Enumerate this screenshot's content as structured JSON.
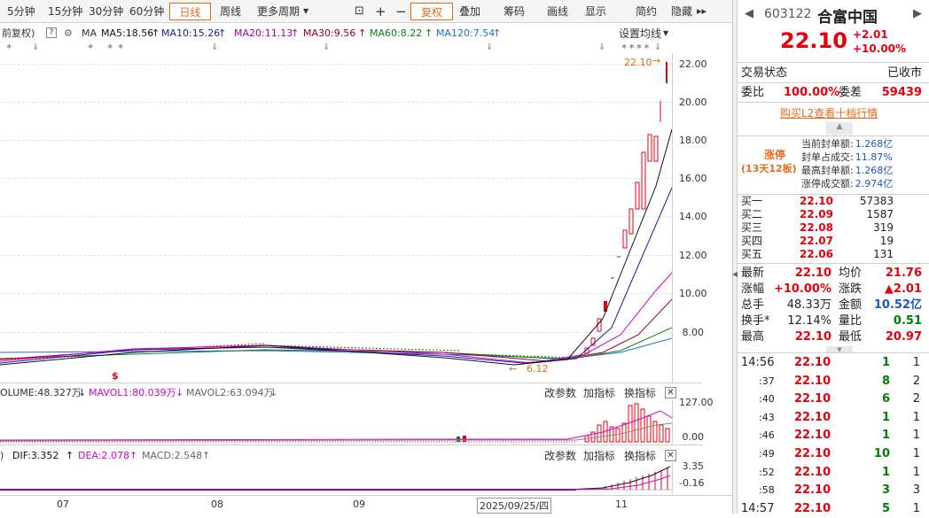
{
  "toolbar": {
    "periods": [
      "5分钟",
      "15分钟",
      "30分钟",
      "60分钟",
      "日线",
      "周线",
      "更多周期"
    ],
    "selected_period": "日线",
    "tools": [
      "复权",
      "叠加",
      "筹码",
      "画线",
      "显示",
      "简约",
      "隐藏"
    ],
    "nav_arrows": "▸▸"
  },
  "indicator_bar": {
    "prefix": "前复权)",
    "ma_label": "MA",
    "ma5": "MA5:18.56",
    "ma10": "MA10:15.26",
    "ma20": "MA20:11.13",
    "ma30": "MA30:9.56",
    "ma60": "MA60:8.22",
    "ma120": "MA120:7.54",
    "settings": "设置均线"
  },
  "colors": {
    "ma5": "#111111",
    "ma10": "#1a1aa6",
    "ma20": "#d400d4",
    "ma30": "#a0001a",
    "ma60": "#108010",
    "ma120": "#1a70e0",
    "up": "#e8000b",
    "down": "#008000"
  },
  "annotations": {
    "high": "22.10",
    "low": "6.12"
  },
  "volume_bar": {
    "label": "OLUME:48.327万",
    "mavol1": "MAVOL1:80.039万",
    "mavol2": "MAVOL2:63.094万",
    "change": "改参数",
    "add": "加指标",
    "switch": "换指标"
  },
  "macd_bar": {
    "prefix": ")",
    "dif": "DIF:3.352",
    "dea": "DEA:2.078",
    "macd": "MACD:2.548",
    "change": "改参数",
    "add": "加指标",
    "switch": "换指标"
  },
  "x_axis": [
    "07",
    "08",
    "09",
    "2025/09/25/四",
    "11"
  ],
  "chart_data": [
    {
      "type": "candlestick",
      "title": "",
      "y_ticks": [
        "22.00",
        "20.00",
        "18.00",
        "16.00",
        "14.00",
        "12.00",
        "10.00",
        "8.00"
      ],
      "ylim": [
        6.0,
        23.0
      ],
      "series": [
        {
          "name": "MA5",
          "values": [
            6.9,
            7.0,
            7.1,
            7.2,
            7.3,
            7.3,
            7.4,
            7.5,
            7.5,
            7.5,
            7.4,
            7.3,
            7.2,
            7.1,
            7.0,
            6.8,
            6.6,
            6.5,
            6.6,
            7.2,
            9.0,
            12.0,
            15.6,
            18.56
          ]
        },
        {
          "name": "MA10",
          "values": [
            6.9,
            7.0,
            7.0,
            7.1,
            7.2,
            7.3,
            7.3,
            7.4,
            7.4,
            7.4,
            7.4,
            7.3,
            7.3,
            7.2,
            7.1,
            7.0,
            6.8,
            6.7,
            6.6,
            6.8,
            7.8,
            9.6,
            12.4,
            15.26
          ]
        },
        {
          "name": "MA20",
          "values": [
            7.0,
            7.0,
            7.0,
            7.1,
            7.1,
            7.2,
            7.2,
            7.3,
            7.3,
            7.3,
            7.3,
            7.3,
            7.2,
            7.2,
            7.1,
            7.1,
            7.0,
            6.9,
            6.8,
            6.8,
            7.2,
            8.1,
            9.6,
            11.13
          ]
        }
      ],
      "candles": [
        {
          "o": 22.1,
          "c": 22.1,
          "h": 22.1,
          "l": 20.97
        }
      ]
    },
    {
      "type": "bar",
      "title": "",
      "y_ticks": [
        "127.00",
        "0.00"
      ],
      "ylim": [
        0,
        127
      ]
    },
    {
      "type": "bar",
      "title": "",
      "y_ticks": [
        "3.35",
        "-0.16"
      ],
      "ylim": [
        -0.16,
        3.35
      ]
    }
  ],
  "quote": {
    "code": "603122",
    "name": "合富中国",
    "price": "22.10",
    "change": "+2.01",
    "change_pct": "+10.00%",
    "status_label": "交易状态",
    "status_value": "已收市",
    "wb_label": "委比",
    "wb_value": "100.00%",
    "wc_label": "委差",
    "wc_value": "59439",
    "l2_link": "购买L2查看十档行情",
    "limit_title": "涨停",
    "limit_sub": "(13天12板)",
    "seal_rows": [
      {
        "label": "当前封单额:",
        "value": "1.268亿"
      },
      {
        "label": "封单占成交:",
        "value": "11.87%"
      },
      {
        "label": "最高封单额:",
        "value": "1.268亿"
      },
      {
        "label": "涨停成交额:",
        "value": "2.974亿"
      }
    ],
    "bids": [
      {
        "label": "买一",
        "price": "22.10",
        "vol": "57383"
      },
      {
        "label": "买二",
        "price": "22.09",
        "vol": "1587"
      },
      {
        "label": "买三",
        "price": "22.08",
        "vol": "319"
      },
      {
        "label": "买四",
        "price": "22.07",
        "vol": "19"
      },
      {
        "label": "买五",
        "price": "22.06",
        "vol": "131"
      }
    ],
    "stats": [
      {
        "l1": "最新",
        "v1": "22.10",
        "l2": "均价",
        "v2": "21.76"
      },
      {
        "l1": "涨幅",
        "v1": "+10.00%",
        "l2": "涨跌",
        "v2": "▲2.01"
      },
      {
        "l1": "总手",
        "v1": "48.33万",
        "l2": "金额",
        "v2": "10.52亿"
      },
      {
        "l1": "换手*",
        "v1": "12.14%",
        "l2": "量比",
        "v2": "0.51"
      },
      {
        "l1": "最高",
        "v1": "22.10",
        "l2": "最低",
        "v2": "20.97"
      }
    ],
    "ticks": [
      {
        "t": "14:56",
        "p": "22.10",
        "v": "1",
        "n": "1"
      },
      {
        "t": ":37",
        "p": "22.10",
        "v": "8",
        "n": "2"
      },
      {
        "t": ":40",
        "p": "22.10",
        "v": "6",
        "n": "2"
      },
      {
        "t": ":43",
        "p": "22.10",
        "v": "1",
        "n": "1"
      },
      {
        "t": ":46",
        "p": "22.10",
        "v": "1",
        "n": "1"
      },
      {
        "t": ":49",
        "p": "22.10",
        "v": "10",
        "n": "1"
      },
      {
        "t": ":52",
        "p": "22.10",
        "v": "1",
        "n": "1"
      },
      {
        "t": ":58",
        "p": "22.10",
        "v": "3",
        "n": "3"
      },
      {
        "t": "14:57",
        "p": "22.10",
        "v": "5",
        "n": "1"
      }
    ]
  }
}
